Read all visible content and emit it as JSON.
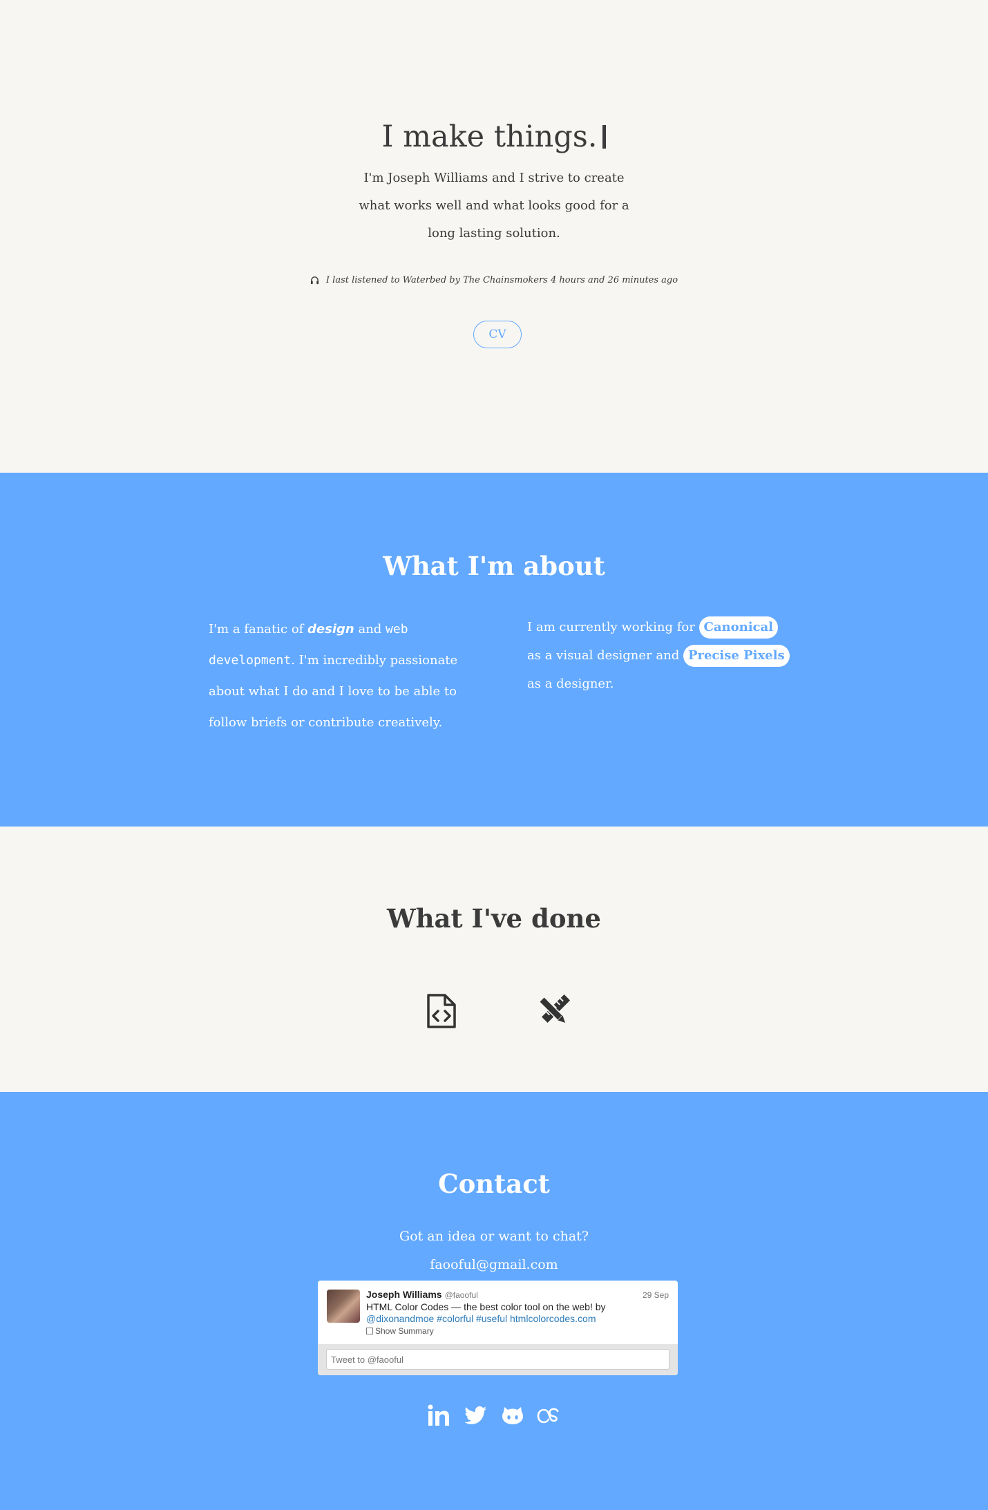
{
  "hero": {
    "title": "I make things.",
    "description": "I'm Joseph Williams and I strive to create what works well and what looks good for a long lasting solution.",
    "listening": "I last listened to Waterbed by The Chainsmokers 4 hours and 26 minutes ago",
    "cv_label": "CV"
  },
  "about": {
    "title": "What I'm about",
    "left": {
      "text1": "I'm a fanatic of ",
      "kw_design": "design",
      "text2": " and ",
      "kw_web": "web development",
      "text3": ". I'm incredibly passionate about what I do and I love to be able to follow briefs or contribute creatively."
    },
    "right": {
      "text1": "I am currently working for ",
      "company1": "Canonical",
      "text2": " as a visual designer and ",
      "company2": "Precise Pixels",
      "text3": " as a designer."
    }
  },
  "done": {
    "title": "What I've done",
    "icons": [
      "file-code-icon",
      "design-tools-icon"
    ]
  },
  "contact": {
    "title": "Contact",
    "prompt": "Got an idea or want to chat?",
    "email": "faooful@gmail.com",
    "tweet": {
      "name": "Joseph Williams",
      "handle": "@faooful",
      "date": "29 Sep",
      "text_plain": "HTML Color Codes — the best color tool on the web! by ",
      "text_links": "@dixonandmoe #colorful #useful htmlcolorcodes.com",
      "summary": "Show Summary",
      "reply_placeholder": "Tweet to @faooful"
    },
    "social": [
      "linkedin-icon",
      "twitter-icon",
      "github-icon",
      "lastfm-icon"
    ]
  },
  "colors": {
    "background": "#f7f6f2",
    "accent": "#63a9ff",
    "text": "#3b3b3b"
  }
}
